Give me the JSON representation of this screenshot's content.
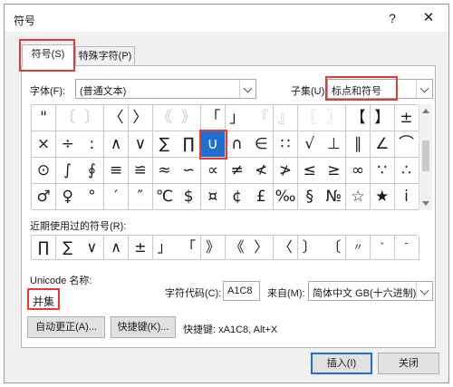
{
  "window": {
    "title": "符号",
    "help_label": "?",
    "close_label": "✕"
  },
  "tabs": [
    {
      "label": "符号(S)",
      "active": true
    },
    {
      "label": "特殊字符(P)",
      "active": false
    }
  ],
  "font": {
    "label": "字体(F):",
    "value": "(普通文本)"
  },
  "subset": {
    "label": "子集(U):",
    "value": "标点和符号"
  },
  "symbols": [
    [
      "\"",
      "〔",
      "〕",
      "〈",
      "〉",
      "《",
      "》",
      "「",
      "」",
      "『",
      "』",
      "〖",
      "〗",
      "【",
      "】",
      "±"
    ],
    [
      "×",
      "÷",
      ":",
      "∧",
      "∨",
      "∑",
      "∏",
      "∪",
      "∩",
      "∈",
      "∷",
      "√",
      "⊥",
      "∥",
      "∠",
      "⌒"
    ],
    [
      "⊙",
      "∫",
      "∮",
      "≡",
      "≌",
      "≈",
      "∽",
      "∝",
      "≠",
      "≮",
      "≯",
      "≤",
      "≥",
      "∞",
      "∵",
      "∴"
    ],
    [
      "♂",
      "♀",
      "°",
      "′",
      "″",
      "℃",
      "$",
      "¤",
      "¢",
      "£",
      "‰",
      "§",
      "№",
      "☆",
      "★",
      "i"
    ]
  ],
  "light_cells": [
    "0-1",
    "0-2",
    "0-5",
    "0-6",
    "0-9",
    "0-10",
    "0-11",
    "0-12"
  ],
  "selected_cell": "1-7",
  "recent": {
    "label": "近期使用过的符号(R):",
    "symbols": [
      "∏",
      "∑",
      "∨",
      "∧",
      "±",
      "」",
      "「",
      "》",
      "《",
      "〉",
      "〈",
      "〕",
      "〔",
      "〃",
      "ˇ",
      "ˉ"
    ]
  },
  "unicode_name": {
    "label": "Unicode 名称:",
    "value": "并集"
  },
  "char_code": {
    "label": "字符代码(C):",
    "value": "A1C8"
  },
  "from": {
    "label": "来自(M):",
    "value": "简体中文 GB(十六进制)"
  },
  "buttons": {
    "autocorrect": "自动更正(A)...",
    "shortcut_key": "快捷键(K)...",
    "shortcut_text": "快捷键: xA1C8, Alt+X",
    "insert": "插入(I)",
    "cancel": "关闭"
  }
}
